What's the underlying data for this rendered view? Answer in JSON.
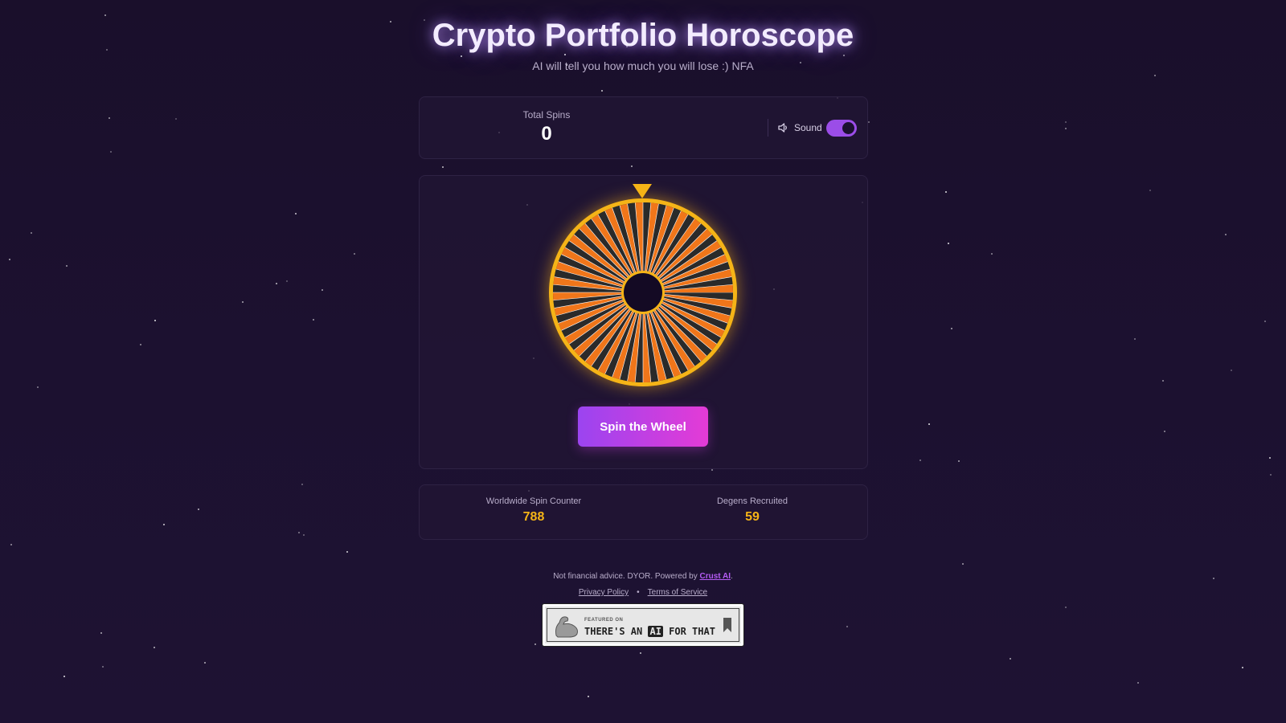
{
  "header": {
    "title": "Crypto Portfolio Horoscope",
    "subtitle": "AI will tell you how much you will lose :) NFA"
  },
  "stats": {
    "total_spins_label": "Total Spins",
    "total_spins_value": "0",
    "sound_label": "Sound",
    "sound_enabled": true,
    "sound_icon": "speaker-icon"
  },
  "wheel": {
    "spin_button_label": "Spin the Wheel",
    "pointer_icon": "triangle-down-icon",
    "colors": {
      "rim": "#f5b417",
      "segment_a": "#f0761a",
      "segment_b": "#2a2a2a",
      "divider": "#ffffff",
      "hub": "#140a24"
    }
  },
  "global": {
    "worldwide_label": "Worldwide Spin Counter",
    "worldwide_value": "788",
    "degens_label": "Degens Recruited",
    "degens_value": "59"
  },
  "footer": {
    "disclaimer": "Not financial advice. DYOR. Powered by ",
    "powered_link": "Crust AI",
    "period": ".",
    "privacy": "Privacy Policy",
    "separator": "•",
    "terms": "Terms of Service",
    "badge_small": "FEATURED ON",
    "badge_main_1": "THERE'S AN ",
    "badge_main_ai": "AI",
    "badge_main_2": " FOR THAT"
  }
}
